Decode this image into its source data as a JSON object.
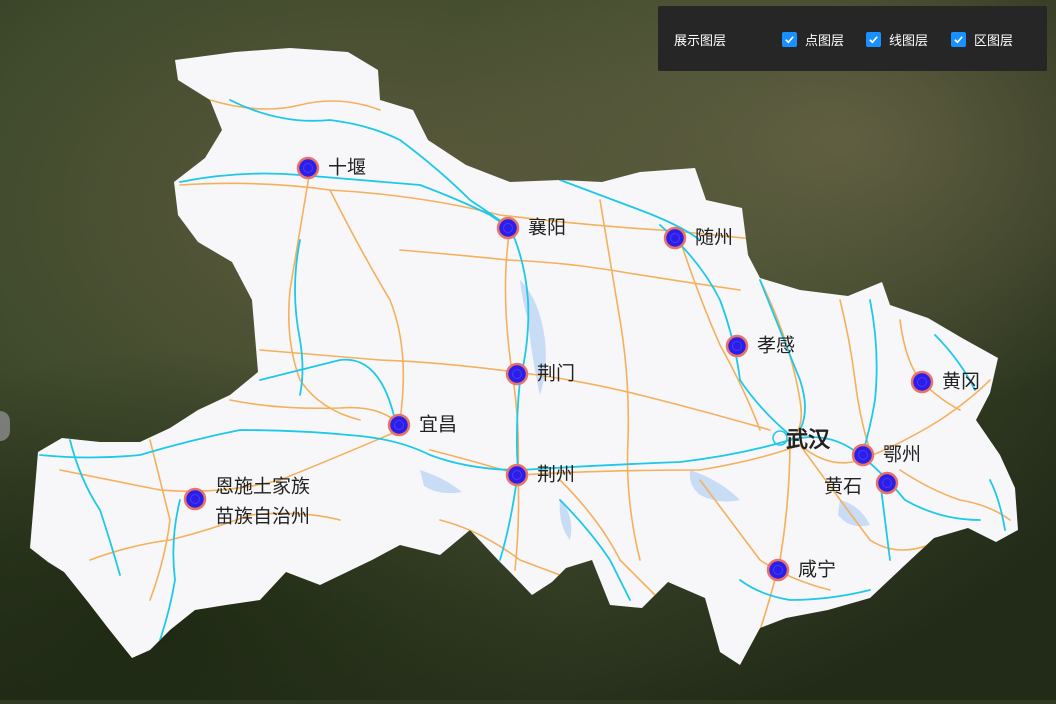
{
  "layer_panel": {
    "title": "展示图层",
    "checkboxes": [
      {
        "label": "点图层",
        "checked": true
      },
      {
        "label": "线图层",
        "checked": true
      },
      {
        "label": "区图层",
        "checked": true
      }
    ]
  },
  "capital": {
    "name": "武汉"
  },
  "cities": [
    {
      "id": "shiyan",
      "name": "十堰"
    },
    {
      "id": "xiangyang",
      "name": "襄阳"
    },
    {
      "id": "suizhou",
      "name": "随州"
    },
    {
      "id": "xiaogan",
      "name": "孝感"
    },
    {
      "id": "jingmen",
      "name": "荆门"
    },
    {
      "id": "huanggang",
      "name": "黄冈"
    },
    {
      "id": "yichang",
      "name": "宜昌"
    },
    {
      "id": "ezhou",
      "name": "鄂州"
    },
    {
      "id": "jingzhou",
      "name": "荆州"
    },
    {
      "id": "huangshi",
      "name": "黄石"
    },
    {
      "id": "enshi",
      "name": "恩施土家族苗族自治州",
      "lines": [
        "恩施土家族",
        "苗族自治州"
      ]
    },
    {
      "id": "xianning",
      "name": "咸宁"
    }
  ],
  "colors": {
    "province_fill": "#f7f7f9",
    "river": "#1ec8e8",
    "road": "#f5b05c",
    "lake": "#c9dcf5",
    "marker_fill": "#2a1ee8",
    "marker_stroke": "#e8736a",
    "checkbox": "#1890ff",
    "panel_bg": "#262626"
  }
}
